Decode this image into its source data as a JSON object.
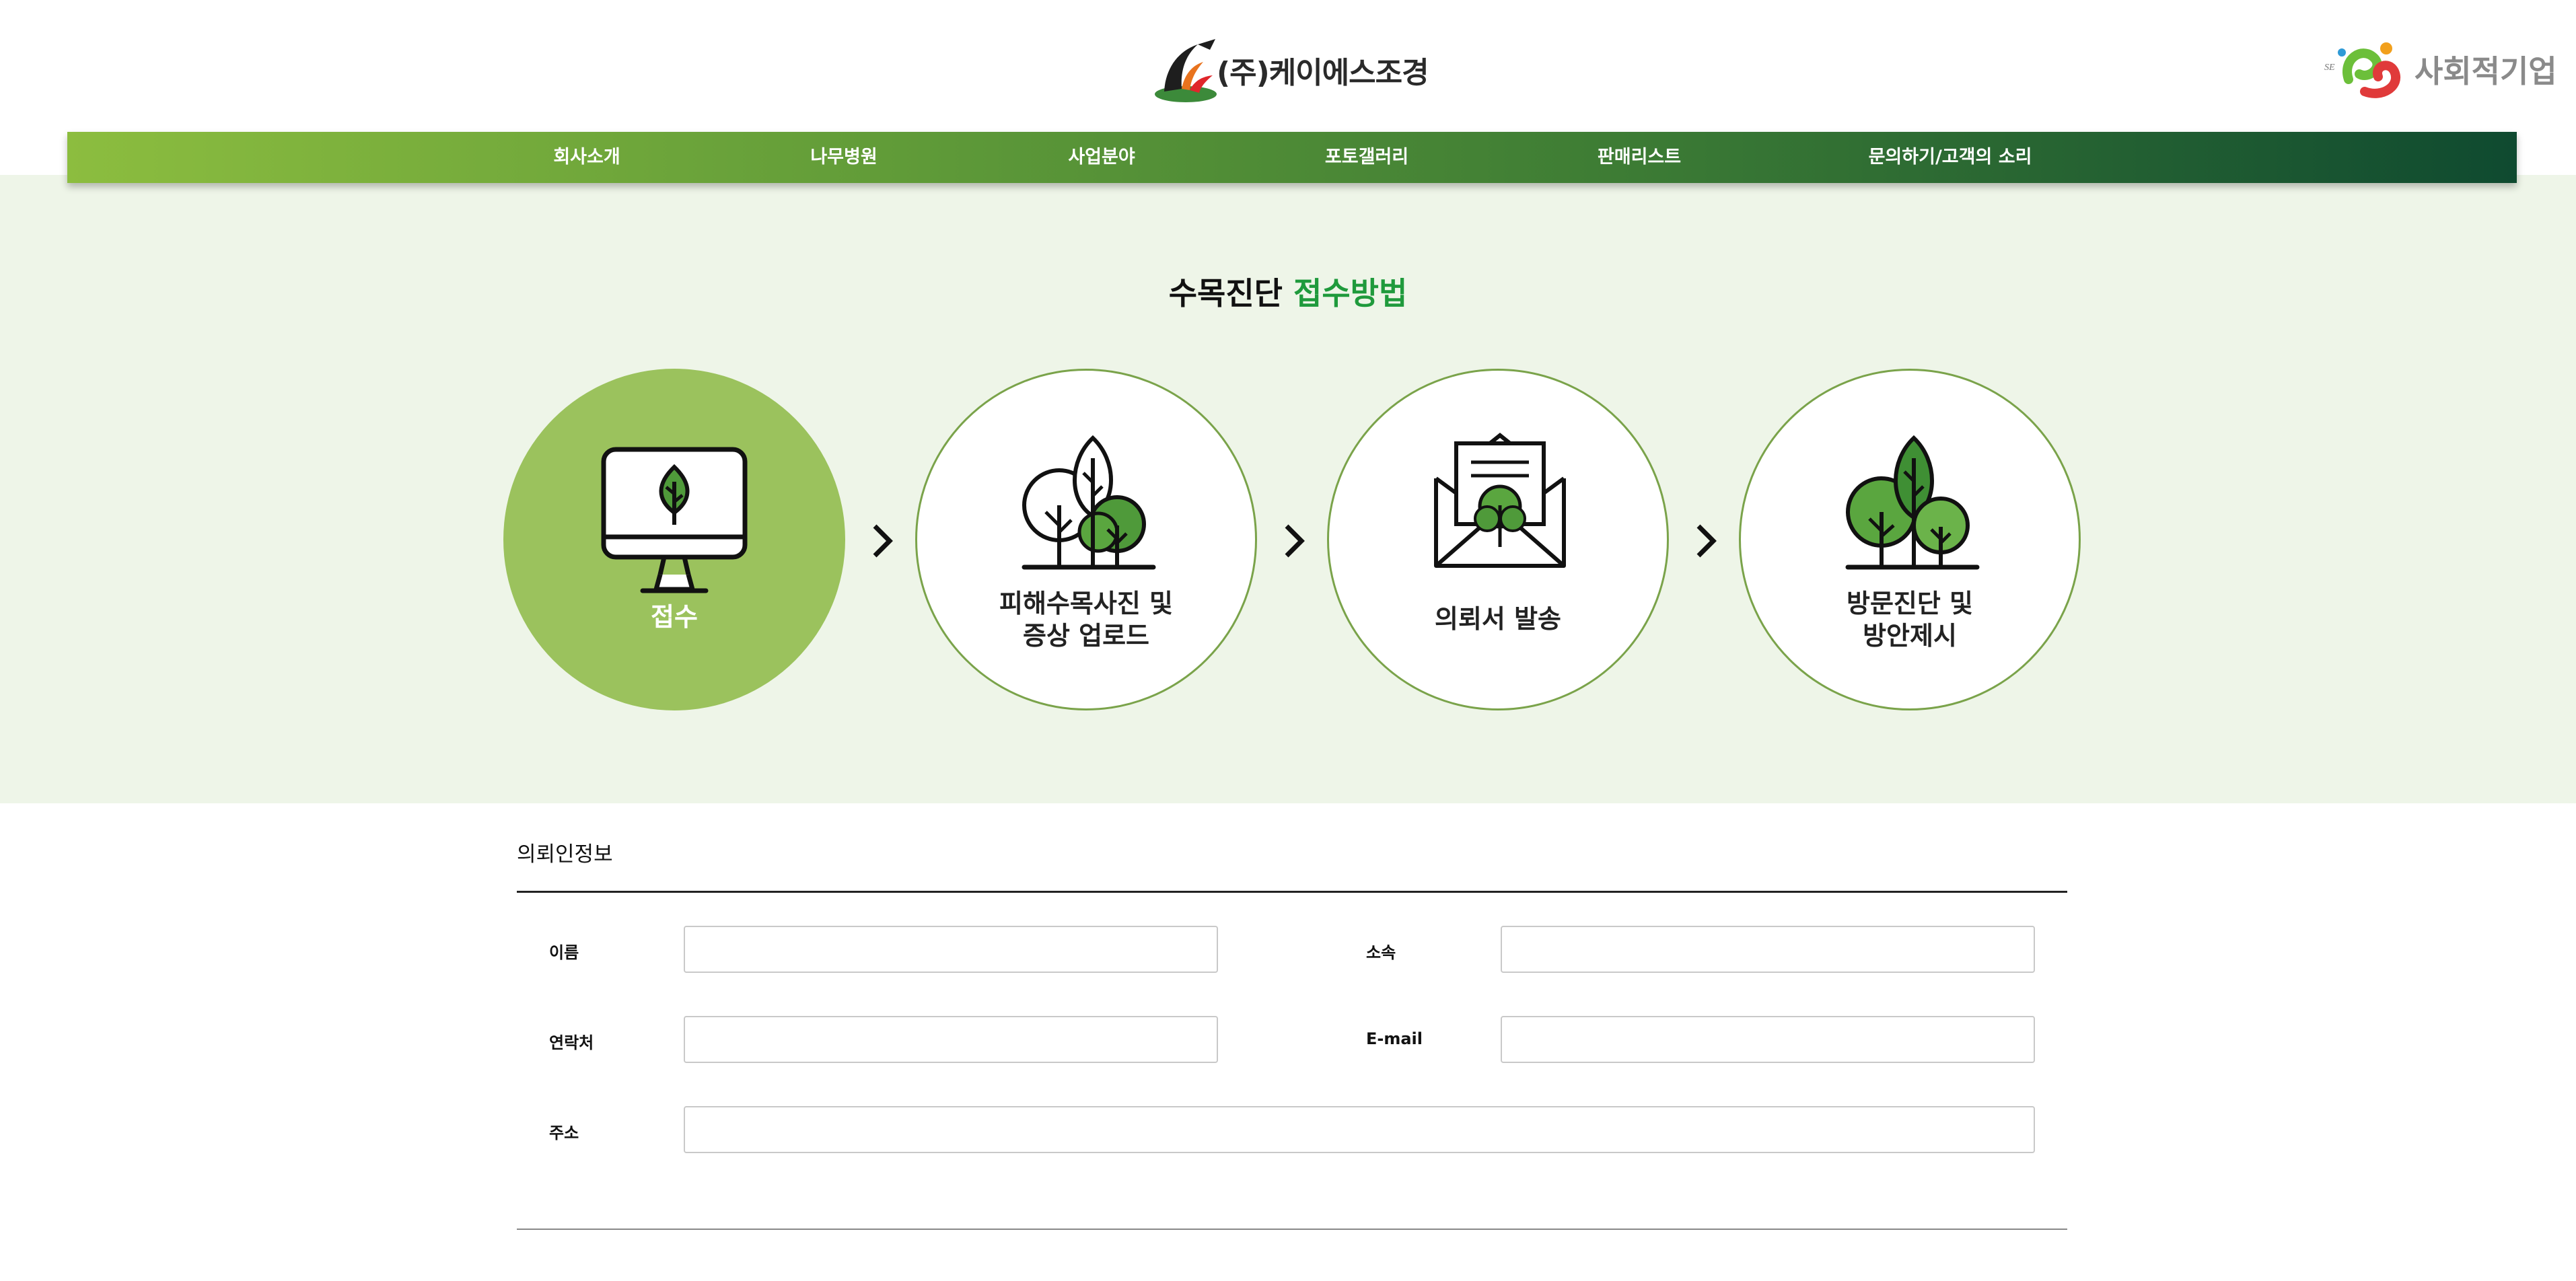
{
  "header": {
    "company_name": "(주)케이에스조경",
    "social_enterprise": "사회적기업"
  },
  "nav": [
    {
      "label": "회사소개"
    },
    {
      "label": "나무병원"
    },
    {
      "label": "사업분야"
    },
    {
      "label": "포토갤러리"
    },
    {
      "label": "판매리스트"
    },
    {
      "label": "문의하기/고객의 소리"
    }
  ],
  "hero": {
    "title_main": "수목진단",
    "title_highlight": "접수방법",
    "steps": [
      {
        "line1": "접수",
        "line2": "",
        "icon": "computer-leaf-icon",
        "active": true
      },
      {
        "line1": "피해수목사진 및",
        "line2": "증상 업로드",
        "icon": "trees-upload-icon",
        "active": false
      },
      {
        "line1": "의뢰서 발송",
        "line2": "",
        "icon": "envelope-tree-icon",
        "active": false
      },
      {
        "line1": "방문진단 및",
        "line2": "방안제시",
        "icon": "tree-cluster-icon",
        "active": false
      }
    ]
  },
  "form": {
    "section_title": "의뢰인정보",
    "fields": {
      "name": {
        "label": "이름",
        "value": "",
        "placeholder": ""
      },
      "affiliation": {
        "label": "소속",
        "value": "",
        "placeholder": ""
      },
      "phone": {
        "label": "연락처",
        "value": "",
        "placeholder": ""
      },
      "email": {
        "label": "E-mail",
        "value": "",
        "placeholder": ""
      },
      "address": {
        "label": "주소",
        "value": "",
        "placeholder": ""
      }
    }
  },
  "colors": {
    "nav_start": "#8cbd3f",
    "nav_end": "#0f4a30",
    "hero_bg": "#eef5e8",
    "step_active": "#9bc25d",
    "step_border": "#7aa34a",
    "title_highlight": "#1f9a3c"
  }
}
